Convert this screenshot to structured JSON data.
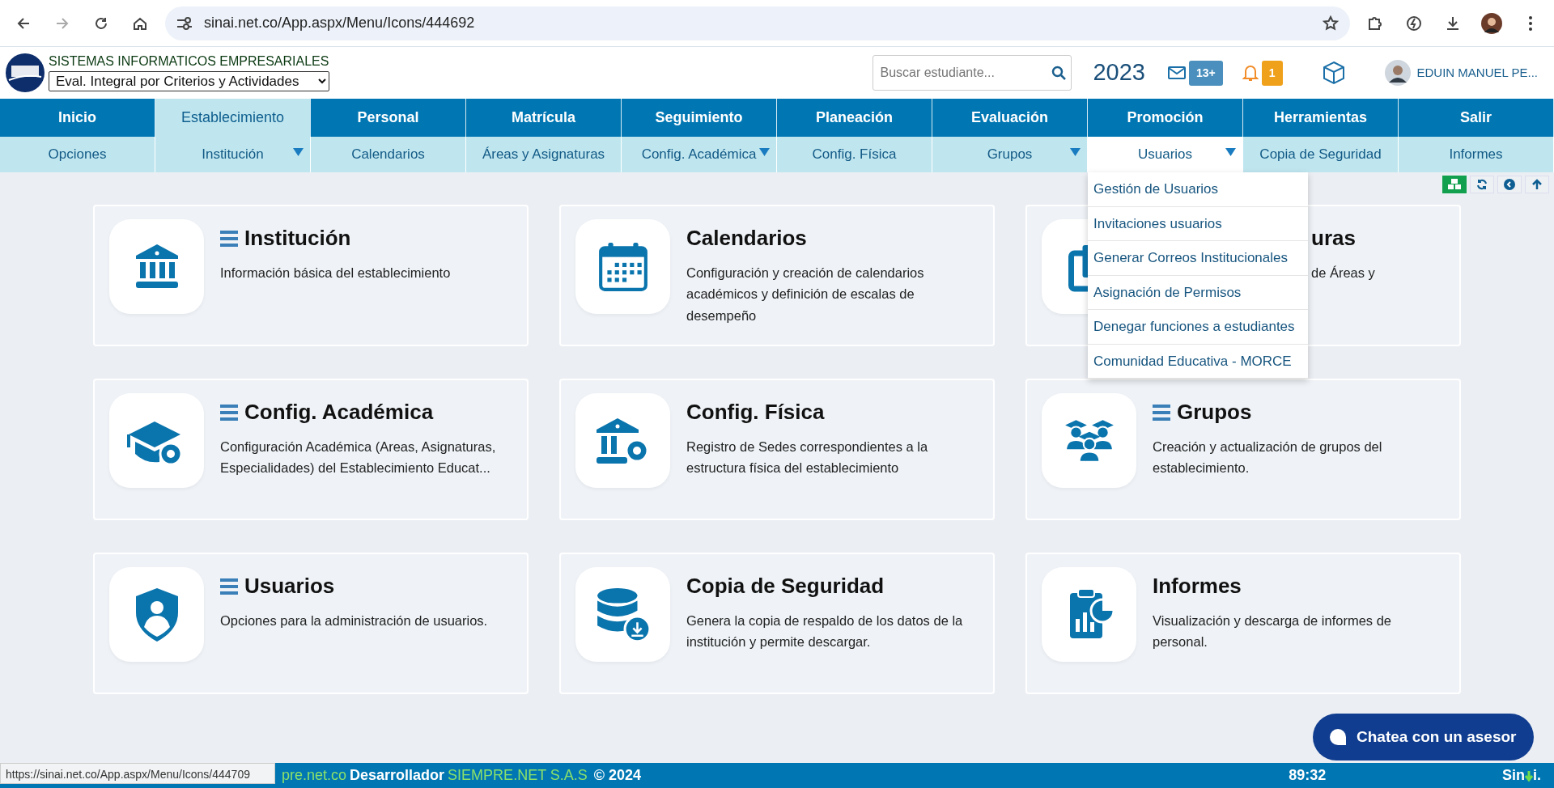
{
  "browser": {
    "url": "sinai.net.co/App.aspx/Menu/Icons/444692",
    "status_url": "https://sinai.net.co/App.aspx/Menu/Icons/444709"
  },
  "header": {
    "company": "SISTEMAS INFORMATICOS EMPRESARIALES",
    "mode_select": "Eval. Integral por Criterios y Actividades",
    "search_placeholder": "Buscar estudiante...",
    "year": "2023",
    "mail_badge": "13+",
    "bell_badge": "1",
    "user_name": "EDUIN MANUEL PE..."
  },
  "nav_main": [
    {
      "label": "Inicio",
      "selected": false
    },
    {
      "label": "Establecimiento",
      "selected": true
    },
    {
      "label": "Personal",
      "selected": false
    },
    {
      "label": "Matrícula",
      "selected": false
    },
    {
      "label": "Seguimiento",
      "selected": false
    },
    {
      "label": "Planeación",
      "selected": false
    },
    {
      "label": "Evaluación",
      "selected": false
    },
    {
      "label": "Promoción",
      "selected": false
    },
    {
      "label": "Herramientas",
      "selected": false
    },
    {
      "label": "Salir",
      "selected": false
    }
  ],
  "nav_sub": [
    {
      "label": "Opciones",
      "has_menu": false,
      "selected": false
    },
    {
      "label": "Institución",
      "has_menu": true,
      "selected": false
    },
    {
      "label": "Calendarios",
      "has_menu": false,
      "selected": false
    },
    {
      "label": "Áreas y Asignaturas",
      "has_menu": false,
      "selected": false
    },
    {
      "label": "Config. Académica",
      "has_menu": true,
      "selected": false
    },
    {
      "label": "Config. Física",
      "has_menu": false,
      "selected": false
    },
    {
      "label": "Grupos",
      "has_menu": true,
      "selected": false
    },
    {
      "label": "Usuarios",
      "has_menu": true,
      "selected": true
    },
    {
      "label": "Copia de Seguridad",
      "has_menu": false,
      "selected": false
    },
    {
      "label": "Informes",
      "has_menu": false,
      "selected": false
    }
  ],
  "dropdown": {
    "items": [
      "Gestión de Usuarios",
      "Invitaciones usuarios",
      "Generar Correos Institucionales",
      "Asignación de Permisos",
      "Denegar funciones a estudiantes",
      "Comunidad Educativa - MORCE"
    ]
  },
  "cards": [
    {
      "kind": "bank",
      "title": "Institución",
      "description": "Información básica del establecimiento",
      "has_menu": true,
      "obscured": false
    },
    {
      "kind": "calendar",
      "title": "Calendarios",
      "description": "Configuración y creación de calendarios académicos y definición de escalas de desempeño",
      "has_menu": false,
      "obscured": false
    },
    {
      "kind": "books",
      "title": "uras",
      "description": "de Áreas y",
      "has_menu": false,
      "obscured": true
    },
    {
      "kind": "cap",
      "title": "Config. Académica",
      "description": "Configuración Académica (Areas, Asignaturas, Especialidades) del Establecimiento Educat...",
      "has_menu": true,
      "obscured": false
    },
    {
      "kind": "building",
      "title": "Config. Física",
      "description": "Registro de Sedes correspondientes a la estructura física del establecimiento",
      "has_menu": false,
      "obscured": false
    },
    {
      "kind": "groups",
      "title": "Grupos",
      "description": "Creación y actualización de grupos del establecimiento.",
      "has_menu": true,
      "obscured": false
    },
    {
      "kind": "shield",
      "title": "Usuarios",
      "description": "Opciones para la administración de usuarios.",
      "has_menu": true,
      "obscured": false
    },
    {
      "kind": "database",
      "title": "Copia de Seguridad",
      "description": "Genera la copia de respaldo de los datos de la institución y permite descargar.",
      "has_menu": false,
      "obscured": false
    },
    {
      "kind": "report",
      "title": "Informes",
      "description": "Visualización y descarga de informes de personal.",
      "has_menu": false,
      "obscured": false
    }
  ],
  "chat": {
    "label": "Chatea con un asesor"
  },
  "footer": {
    "site": "pre.net.co",
    "developer_label": "Desarrollador",
    "developer": "SIEMPRE.NET S.A.S",
    "copyright": "© 2024",
    "timer": "89:32",
    "logo_start": "Sin",
    "logo_end": "i."
  }
}
